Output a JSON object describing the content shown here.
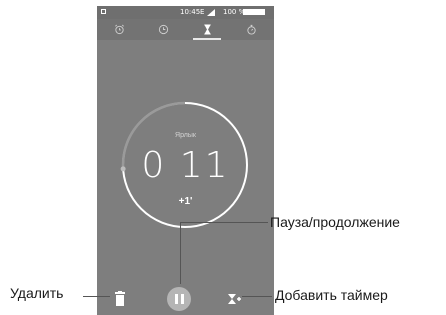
{
  "status": {
    "time": "10:45",
    "network": "E",
    "battery": "100 %"
  },
  "tabs": [
    {
      "icon": "alarm-icon",
      "selected": false
    },
    {
      "icon": "clock-icon",
      "selected": false
    },
    {
      "icon": "hourglass-icon",
      "selected": true
    },
    {
      "icon": "stopwatch-icon",
      "selected": false
    }
  ],
  "timer": {
    "label": "Ярлык",
    "time": "0 11",
    "add_minute": "+1'",
    "progress": 0.26
  },
  "controls": {
    "delete_icon": "trash-icon",
    "pause_icon": "pause-icon",
    "add_timer_icon": "add-timer-icon"
  },
  "callouts": {
    "pause": "Пауза/продолжение",
    "delete": "Удалить",
    "add_timer": "Добавить таймер"
  },
  "colors": {
    "screen_bg": "#7e7e7e",
    "ring": "#ffffff",
    "pause_btn": "#b5b5b5"
  }
}
